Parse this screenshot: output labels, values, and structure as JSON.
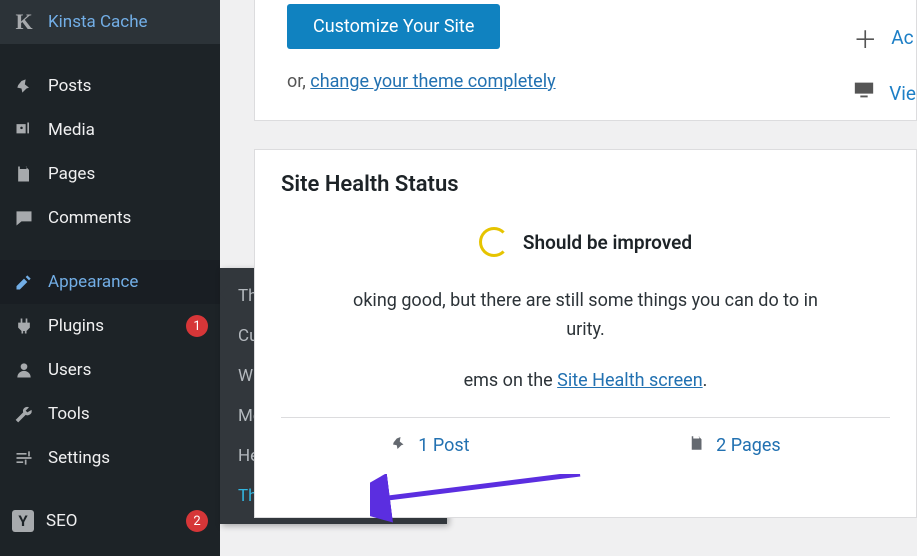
{
  "sidebar": {
    "items": [
      {
        "label": "Kinsta Cache",
        "iconLetter": "K"
      },
      {
        "label": "Posts"
      },
      {
        "label": "Media"
      },
      {
        "label": "Pages"
      },
      {
        "label": "Comments"
      },
      {
        "label": "Appearance"
      },
      {
        "label": "Plugins",
        "badge": "1"
      },
      {
        "label": "Users"
      },
      {
        "label": "Tools"
      },
      {
        "label": "Settings"
      },
      {
        "label": "SEO",
        "badge": "2"
      }
    ]
  },
  "submenu": {
    "items": [
      {
        "label": "Themes"
      },
      {
        "label": "Customize"
      },
      {
        "label": "Widgets"
      },
      {
        "label": "Menus"
      },
      {
        "label": "Header"
      },
      {
        "label": "Theme Editor"
      }
    ]
  },
  "top_panel": {
    "customize_button": "Customize Your Site",
    "or_prefix": "or, ",
    "change_theme_link": "change your theme completely",
    "right": {
      "add": "Ac",
      "view": "Vie"
    }
  },
  "health_panel": {
    "title": "Site Health Status",
    "status": "Should be improved",
    "line1_tail": "oking good, but there are still some things you can do to in",
    "line2_tail": "urity.",
    "line3_prefix": "ems",
    "line3_mid": " on the ",
    "site_health_link": "Site Health screen",
    "period": ".",
    "stat_posts": "1 Post",
    "stat_pages": "2 Pages"
  }
}
